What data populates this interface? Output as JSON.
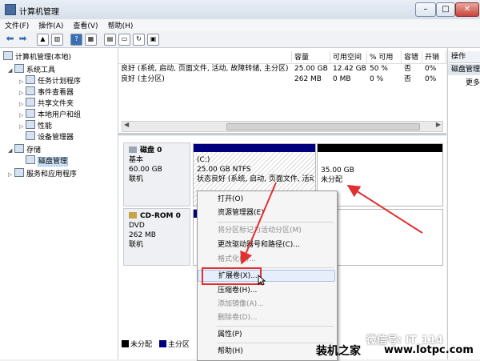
{
  "window": {
    "title": "计算机管理"
  },
  "menu": [
    "文件(F)",
    "操作(A)",
    "查看(V)",
    "帮助(H)"
  ],
  "toolbar": [
    "back-icon",
    "forward-icon",
    "up-folder-icon",
    "show-tree-icon",
    "help-icon",
    "console-icon",
    "properties-icon",
    "open-icon",
    "refresh-icon",
    "export-icon"
  ],
  "tree": [
    {
      "label": "计算机管理(本地)",
      "level": 0,
      "expander": ""
    },
    {
      "label": "系统工具",
      "level": 1,
      "expander": "◢"
    },
    {
      "label": "任务计划程序",
      "level": 2,
      "expander": "▷"
    },
    {
      "label": "事件查看器",
      "level": 2,
      "expander": "▷"
    },
    {
      "label": "共享文件夹",
      "level": 2,
      "expander": "▷"
    },
    {
      "label": "本地用户和组",
      "level": 2,
      "expander": "▷"
    },
    {
      "label": "性能",
      "level": 2,
      "expander": "▷"
    },
    {
      "label": "设备管理器",
      "level": 2,
      "expander": ""
    },
    {
      "label": "存储",
      "level": 1,
      "expander": "◢"
    },
    {
      "label": "磁盘管理",
      "level": 2,
      "expander": "",
      "selected": true
    },
    {
      "label": "服务和应用程序",
      "level": 1,
      "expander": "▷"
    }
  ],
  "volumes": {
    "columns": [
      "",
      "容量",
      "可用空间",
      "% 可用",
      "容错",
      "开销"
    ],
    "rows": [
      [
        "良好 (系统, 启动, 页面文件, 活动, 故障转储, 主分区)",
        "25.00 GB",
        "12.42 GB",
        "50 %",
        "否",
        "0%"
      ],
      [
        "良好 (主分区)",
        "262 MB",
        "0 MB",
        "0 %",
        "否",
        "0%"
      ]
    ]
  },
  "actions": {
    "header": "操作",
    "item1": "磁盘管理",
    "item2": "更多"
  },
  "disks": [
    {
      "name": "磁盘 0",
      "type": "基本",
      "size": "60.00 GB",
      "status": "联机"
    },
    {
      "name": "CD-ROM 0",
      "type": "DVD",
      "size": "262 MB",
      "status": "联机"
    }
  ],
  "partitions": {
    "c": {
      "name": "(C:)",
      "size": "25.00 GB NTFS",
      "status": "状态良好 (系统, 启动, 页面文件, 活动, 故障转储, 主分区)"
    },
    "unalloc": {
      "size": "35.00 GB",
      "status": "未分配"
    }
  },
  "legend": [
    "未分配",
    "主分区"
  ],
  "context_menu": [
    {
      "label": "打开(O)",
      "disabled": false
    },
    {
      "label": "资源管理器(E)",
      "disabled": false
    },
    {
      "sep": true
    },
    {
      "label": "将分区标记为活动分区(M)",
      "disabled": true
    },
    {
      "label": "更改驱动器号和路径(C)...",
      "disabled": false
    },
    {
      "label": "格式化(F)...",
      "disabled": true
    },
    {
      "sep": true
    },
    {
      "label": "扩展卷(X)...",
      "disabled": false,
      "highlight": true
    },
    {
      "label": "压缩卷(H)...",
      "disabled": false
    },
    {
      "label": "添加镜像(A)...",
      "disabled": true
    },
    {
      "label": "删除卷(D)...",
      "disabled": true
    },
    {
      "sep": true
    },
    {
      "label": "属性(P)",
      "disabled": false
    },
    {
      "sep": true
    },
    {
      "label": "帮助(H)",
      "disabled": false
    }
  ],
  "watermark": {
    "wechat": "微信号: IT_114",
    "site_cn": "装机之家",
    "site_url": "www.lotpc.com"
  },
  "colors": {
    "primary_partition": "#00007f",
    "unallocated": "#000000",
    "highlight_box": "#e03030"
  }
}
